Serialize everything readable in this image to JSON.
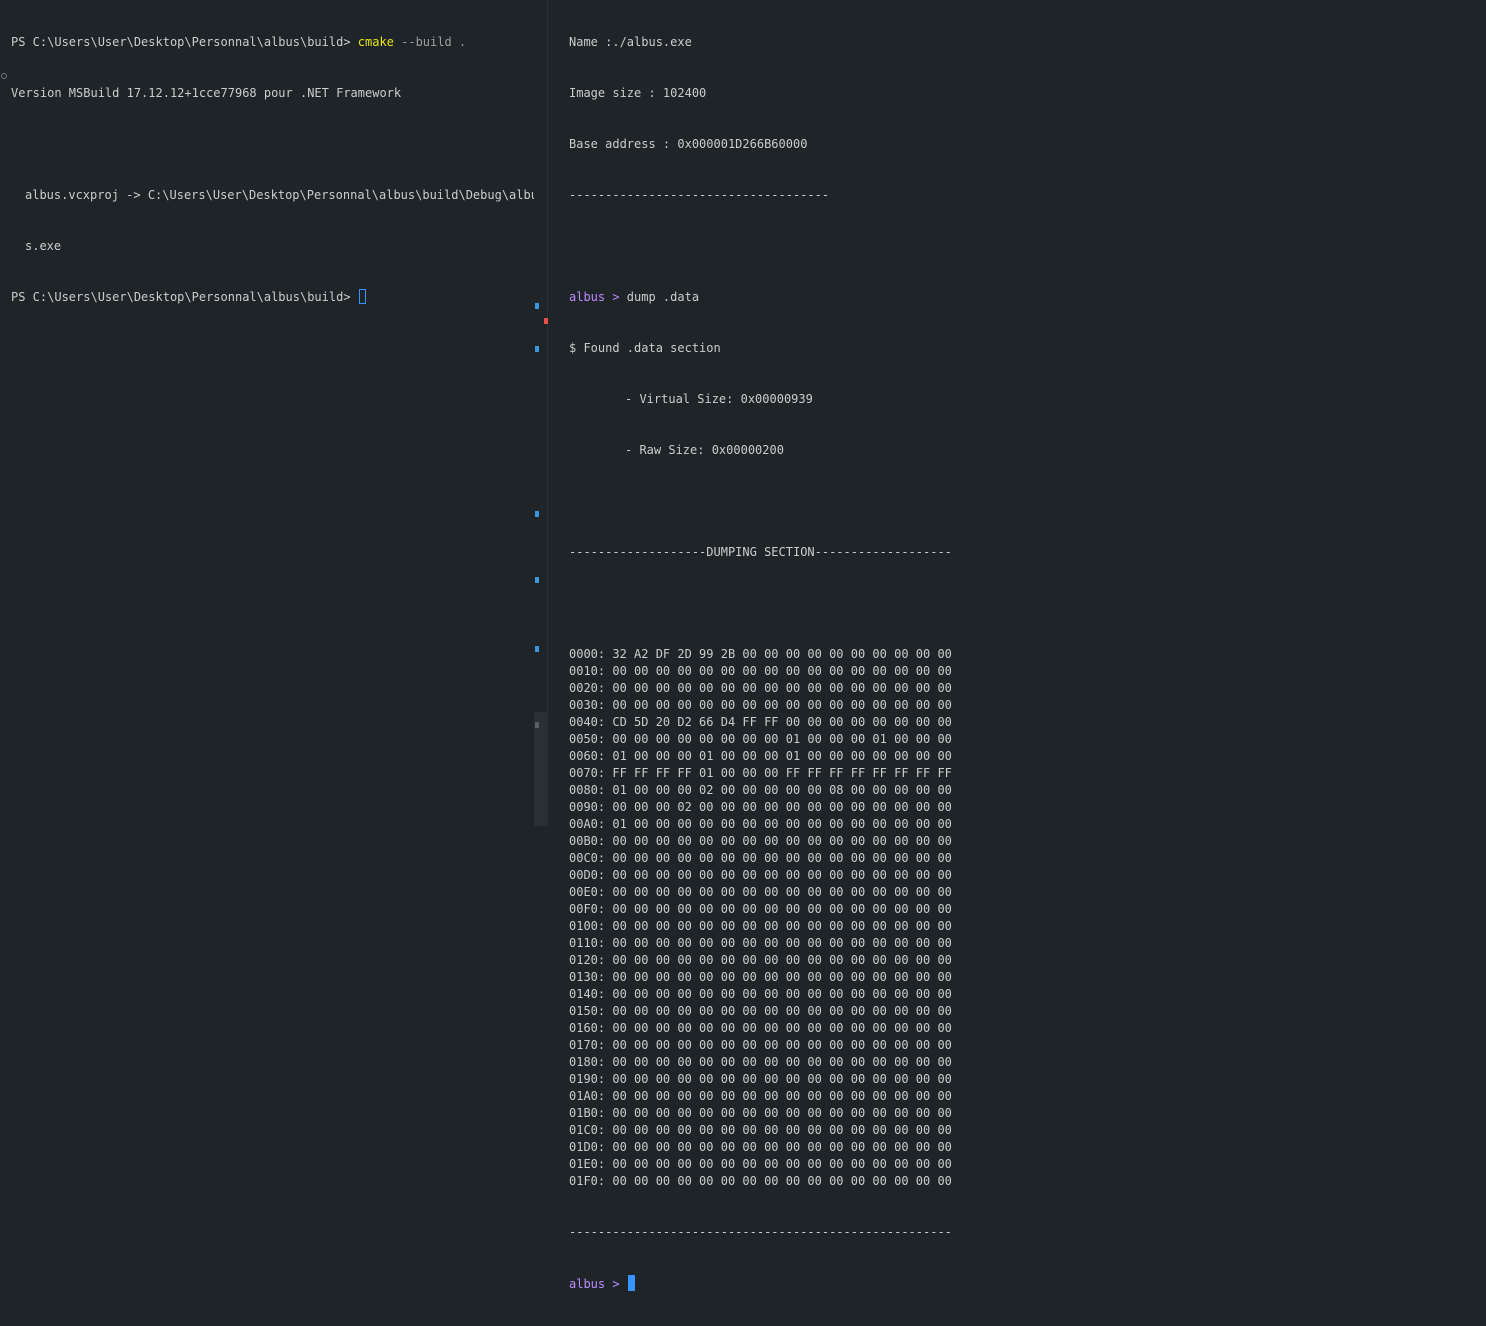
{
  "left_terminal": {
    "line1_prompt": "PS C:\\Users\\User\\Desktop\\Personnal\\albus\\build> ",
    "line1_cmd": "cmake",
    "line1_args": " --build .",
    "line2": "Version MSBuild 17.12.12+1cce77968 pour .NET Framework",
    "line3": "",
    "line4": "albus.vcxproj -> C:\\Users\\User\\Desktop\\Personnal\\albus\\build\\Debug\\albu",
    "line5": "s.exe",
    "line6_prompt": "PS C:\\Users\\User\\Desktop\\Personnal\\albus\\build> "
  },
  "right_terminal": {
    "name_line": "Name :./albus.exe",
    "image_size_line": "Image size : 102400",
    "base_address_line": "Base address : 0x000001D266B60000",
    "separator1": "------------------------------------",
    "prompt_name": "albus >",
    "command": " dump .data",
    "found_line": "$ Found .data section",
    "virtual_size_line": "- Virtual Size: 0x00000939",
    "raw_size_line": "- Raw Size: 0x00000200",
    "dump_header": "-------------------DUMPING SECTION-------------------",
    "hex_rows": [
      "0000: 32 A2 DF 2D 99 2B 00 00 00 00 00 00 00 00 00 00",
      "0010: 00 00 00 00 00 00 00 00 00 00 00 00 00 00 00 00",
      "0020: 00 00 00 00 00 00 00 00 00 00 00 00 00 00 00 00",
      "0030: 00 00 00 00 00 00 00 00 00 00 00 00 00 00 00 00",
      "0040: CD 5D 20 D2 66 D4 FF FF 00 00 00 00 00 00 00 00",
      "0050: 00 00 00 00 00 00 00 00 01 00 00 00 01 00 00 00",
      "0060: 01 00 00 00 01 00 00 00 01 00 00 00 00 00 00 00",
      "0070: FF FF FF FF 01 00 00 00 FF FF FF FF FF FF FF FF",
      "0080: 01 00 00 00 02 00 00 00 00 00 08 00 00 00 00 00",
      "0090: 00 00 00 02 00 00 00 00 00 00 00 00 00 00 00 00",
      "00A0: 01 00 00 00 00 00 00 00 00 00 00 00 00 00 00 00",
      "00B0: 00 00 00 00 00 00 00 00 00 00 00 00 00 00 00 00",
      "00C0: 00 00 00 00 00 00 00 00 00 00 00 00 00 00 00 00",
      "00D0: 00 00 00 00 00 00 00 00 00 00 00 00 00 00 00 00",
      "00E0: 00 00 00 00 00 00 00 00 00 00 00 00 00 00 00 00",
      "00F0: 00 00 00 00 00 00 00 00 00 00 00 00 00 00 00 00",
      "0100: 00 00 00 00 00 00 00 00 00 00 00 00 00 00 00 00",
      "0110: 00 00 00 00 00 00 00 00 00 00 00 00 00 00 00 00",
      "0120: 00 00 00 00 00 00 00 00 00 00 00 00 00 00 00 00",
      "0130: 00 00 00 00 00 00 00 00 00 00 00 00 00 00 00 00",
      "0140: 00 00 00 00 00 00 00 00 00 00 00 00 00 00 00 00",
      "0150: 00 00 00 00 00 00 00 00 00 00 00 00 00 00 00 00",
      "0160: 00 00 00 00 00 00 00 00 00 00 00 00 00 00 00 00",
      "0170: 00 00 00 00 00 00 00 00 00 00 00 00 00 00 00 00",
      "0180: 00 00 00 00 00 00 00 00 00 00 00 00 00 00 00 00",
      "0190: 00 00 00 00 00 00 00 00 00 00 00 00 00 00 00 00",
      "01A0: 00 00 00 00 00 00 00 00 00 00 00 00 00 00 00 00",
      "01B0: 00 00 00 00 00 00 00 00 00 00 00 00 00 00 00 00",
      "01C0: 00 00 00 00 00 00 00 00 00 00 00 00 00 00 00 00",
      "01D0: 00 00 00 00 00 00 00 00 00 00 00 00 00 00 00 00",
      "01E0: 00 00 00 00 00 00 00 00 00 00 00 00 00 00 00 00",
      "01F0: 00 00 00 00 00 00 00 00 00 00 00 00 00 00 00 00"
    ],
    "dump_footer": "-----------------------------------------------------",
    "final_prompt": "albus >"
  },
  "colors": {
    "background": "#1f2428",
    "text": "#cccccc",
    "command_highlight": "#e5e510",
    "prompt_purple": "#bc8cff",
    "cursor": "#3794ff"
  }
}
